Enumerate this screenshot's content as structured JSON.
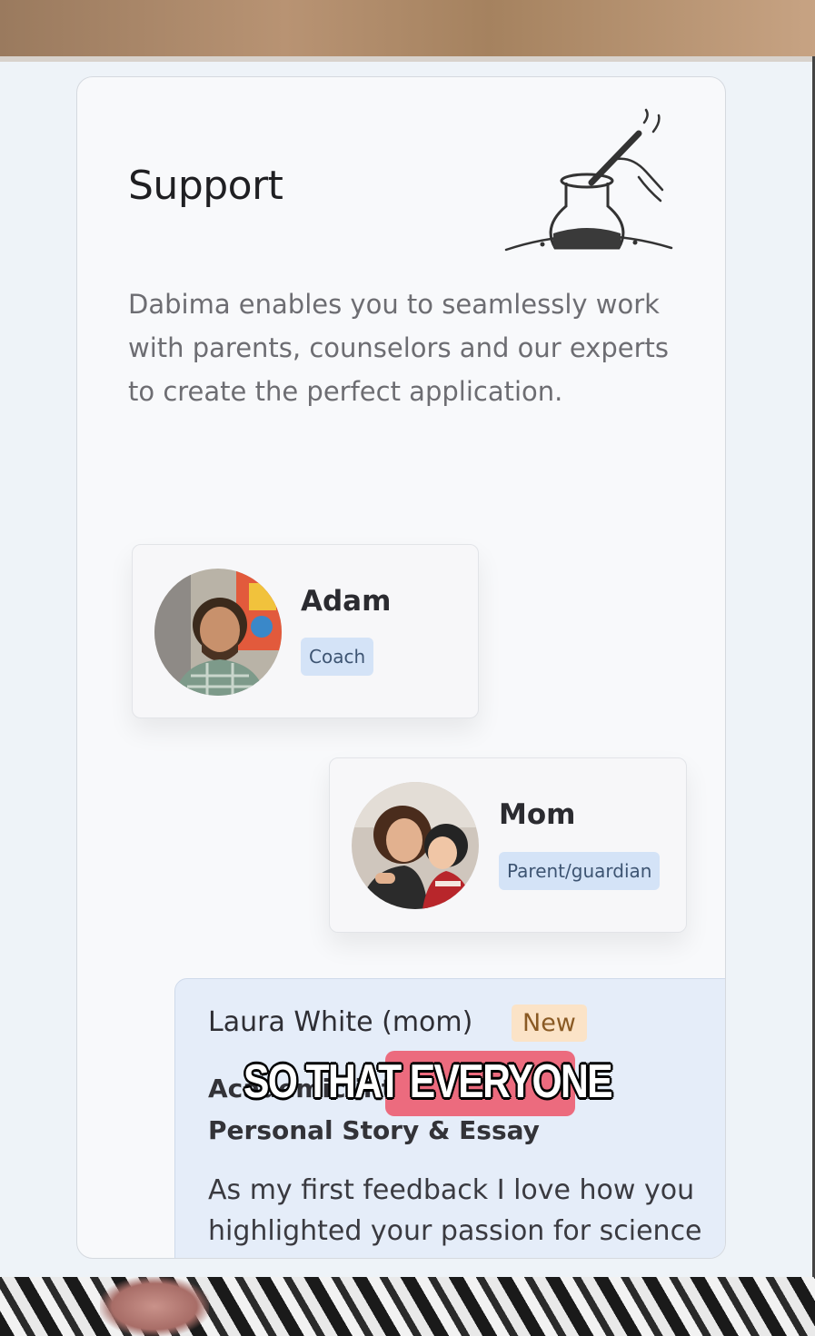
{
  "support": {
    "title": "Support",
    "description": "Dabima enables you to seamlessly work with parents, counselors and our experts to create the perfect application."
  },
  "people": [
    {
      "name": "Adam",
      "role": "Coach"
    },
    {
      "name": "Mom",
      "role": "Parent/guardian"
    }
  ],
  "feedback": {
    "author": "Laura White (mom)",
    "badge": "New",
    "section": "Academic interests",
    "topic": "Personal Story & Essay",
    "line1": "As my first feedback I love how you",
    "line2": "highlighted your passion for science"
  },
  "caption": {
    "text": "SO THAT EVERYONE"
  },
  "colors": {
    "card_bg": "#f8f9fb",
    "role_badge_bg": "#d4e3f7",
    "new_badge_bg": "#fbe3c7",
    "feedback_bg": "#e5edf9",
    "caption_highlight": "#ec6b7e"
  }
}
